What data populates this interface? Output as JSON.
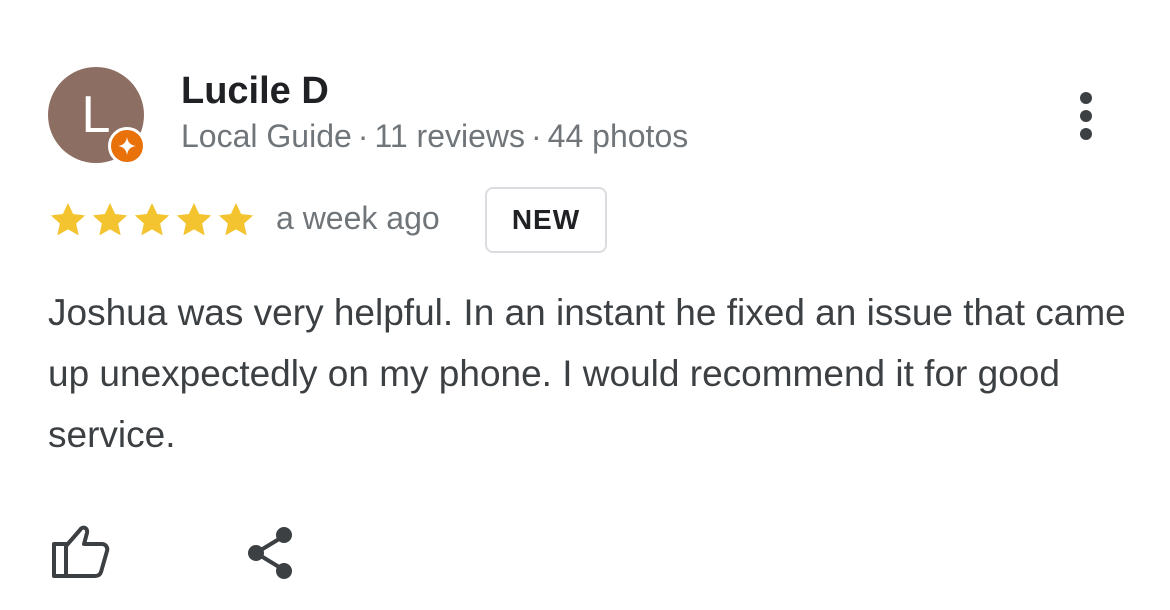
{
  "reviewer": {
    "initial": "L",
    "name": "Lucile D",
    "badge": "Local Guide",
    "reviews": "11 reviews",
    "photos": "44 photos",
    "separator": "·"
  },
  "rating": {
    "stars": 5,
    "max": 5,
    "star_color": "#f4c430"
  },
  "time_ago": "a week ago",
  "new_badge": "NEW",
  "review_text": "Joshua was very helpful. In an instant he fixed an issue that came up unexpectedly on my phone. I would recommend it for good service.",
  "icons": {
    "avatar_badge": "local-guide-star-icon",
    "more": "more-vert-icon",
    "like": "thumbs-up-icon",
    "share": "share-icon"
  },
  "colors": {
    "avatar_bg": "#8d6e63",
    "guide_badge": "#e8710a",
    "secondary_text": "#70757a"
  }
}
